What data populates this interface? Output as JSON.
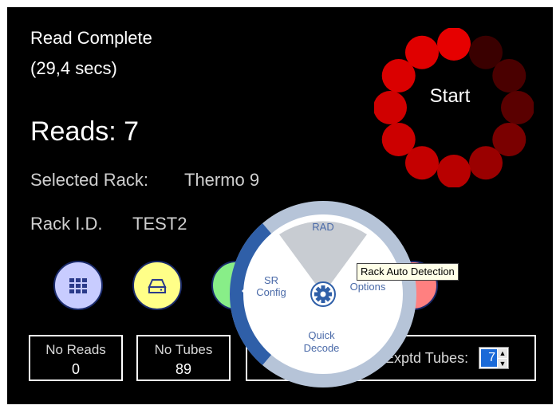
{
  "status": {
    "line1": "Read Complete",
    "line2": "(29,4 secs)",
    "reads": "Reads: 7",
    "selected_rack_label": "Selected Rack:",
    "selected_rack_value": "Thermo 9",
    "rack_id_label": "Rack I.D.",
    "rack_id_value": "TEST2"
  },
  "start_button": {
    "label": "Start"
  },
  "spinner_colors": [
    "#e60000",
    "#3a0000",
    "#4a0000",
    "#5a0000",
    "#7a0000",
    "#9a0000",
    "#b80000",
    "#c40000",
    "#cc0000",
    "#d00000",
    "#da0000",
    "#e00000"
  ],
  "action_buttons": [
    {
      "name": "grid-icon",
      "color": "#c8ccff"
    },
    {
      "name": "drive-icon",
      "color": "#ffff88"
    },
    {
      "name": "unknown-green",
      "color": "#88ee88"
    },
    {
      "name": "unknown-red",
      "color": "#ff8080"
    }
  ],
  "counters": {
    "no_reads": {
      "label": "No Reads",
      "value": "0"
    },
    "no_tubes": {
      "label": "No Tubes",
      "value": "89"
    },
    "expected_tubes": {
      "label": "Exptd Tubes:",
      "value": "7"
    }
  },
  "radial_menu": {
    "rad": "RAD",
    "sr_config_line1": "SR",
    "sr_config_line2": "Config",
    "options": "Options",
    "quick_decode_line1": "Quick",
    "quick_decode_line2": "Decode",
    "accent": "#2f5fa8"
  },
  "tooltip": {
    "text": "Rack Auto Detection"
  }
}
